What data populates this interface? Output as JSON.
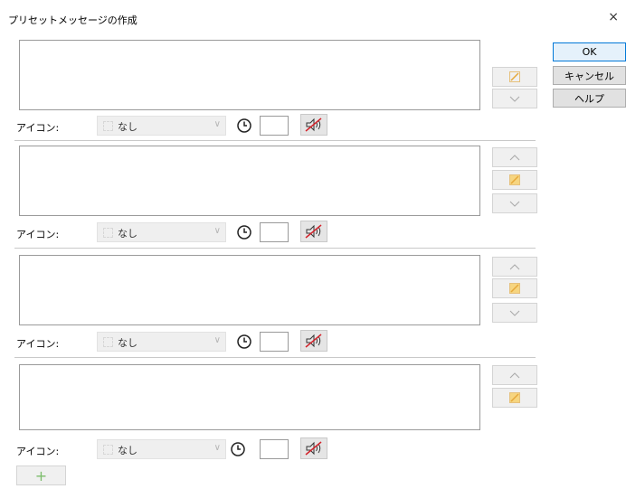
{
  "window": {
    "title": "プリセットメッセージの作成",
    "close_glyph": "×"
  },
  "dialog_buttons": {
    "ok": "OK",
    "cancel": "キャンセル",
    "help": "ヘルプ"
  },
  "entries": [
    {
      "message": "",
      "icon_label": "アイコン:",
      "icon_value": "なし",
      "timer_value": "",
      "has_up": false,
      "has_down": true
    },
    {
      "message": "",
      "icon_label": "アイコン:",
      "icon_value": "なし",
      "timer_value": "",
      "has_up": true,
      "has_down": true
    },
    {
      "message": "",
      "icon_label": "アイコン:",
      "icon_value": "なし",
      "timer_value": "",
      "has_up": true,
      "has_down": true
    },
    {
      "message": "",
      "icon_label": "アイコン:",
      "icon_value": "なし",
      "timer_value": "",
      "has_up": true,
      "has_down": false
    }
  ],
  "add_button": {
    "glyph": "+"
  },
  "icons": {
    "close": "close-icon",
    "up": "chevron-up-icon",
    "down": "chevron-down-icon",
    "edit": "edit-icon",
    "clock": "clock-icon",
    "mute": "speaker-muted-icon",
    "add": "plus-icon"
  },
  "colors": {
    "ok_border": "#0078d7",
    "add_plus": "#7cbd6c",
    "edit_icon": "#e6a83a"
  }
}
